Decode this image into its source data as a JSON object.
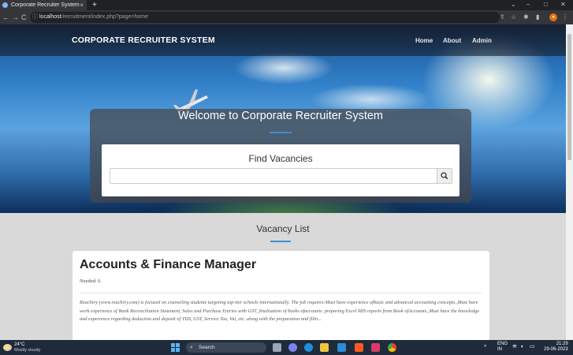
{
  "browser": {
    "tab_title": "Corporate Recruiter System",
    "tab_close": "×",
    "new_tab": "+",
    "url_host": "localhost",
    "url_path": "/recruitment/index.php?page=home"
  },
  "navbar": {
    "brand": "CORPORATE RECRUITER SYSTEM",
    "links": [
      "Home",
      "About",
      "Admin"
    ]
  },
  "hero": {
    "welcome": "Welcome to Corporate Recruiter System",
    "find_title": "Find Vacancies",
    "search_placeholder": "",
    "search_icon": "search-icon"
  },
  "vacancy_list": {
    "heading": "Vacancy List",
    "items": [
      {
        "title": "Accounts & Finance Manager",
        "needed": "Needed: 6",
        "description": "Reachivy (www.reachivy.com) is focused on counseling students targeting top-tier schools internationally. The job requires:Must have experience ofbasic and advanced accounting concepts.,Must have work experience of Bank Reconciliation Statement, Sales and Purchase Entries with GST, finalization of books ofaccounts. preparing Excel MIS reports from Book ofAccounts.,Must have the knowledge and experience regarding deduction and deposit of TDS, GST, Service Tax, Vat, etc. along with the preparation and filin..."
      }
    ]
  },
  "taskbar": {
    "temperature": "24°C",
    "weather": "Mostly cloudy",
    "search_label": "Search",
    "lang_top": "ENG",
    "lang_bottom": "IN",
    "time": "21:29",
    "date": "29-06-2023"
  },
  "colors": {
    "accent": "#3a8fd9",
    "navbar_text": "#ffffff",
    "page_bg": "#d9d9d9"
  }
}
